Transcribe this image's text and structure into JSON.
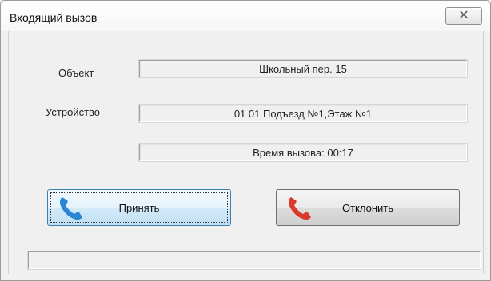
{
  "window": {
    "title": "Входящий вызов",
    "close_glyph": "✕"
  },
  "form": {
    "object_label": "Объект",
    "object_value": "Школьный пер. 15",
    "device_label": "Устройство",
    "device_value": "01 01 Подъезд №1,Этаж №1",
    "call_time": "Время вызова: 00:17"
  },
  "buttons": {
    "accept_label": "Принять",
    "accept_icon": "phone-icon",
    "accept_color": "#2a86d4",
    "decline_label": "Отклонить",
    "decline_icon": "phone-icon",
    "decline_color": "#d93a2b"
  },
  "status": {
    "text": ""
  }
}
